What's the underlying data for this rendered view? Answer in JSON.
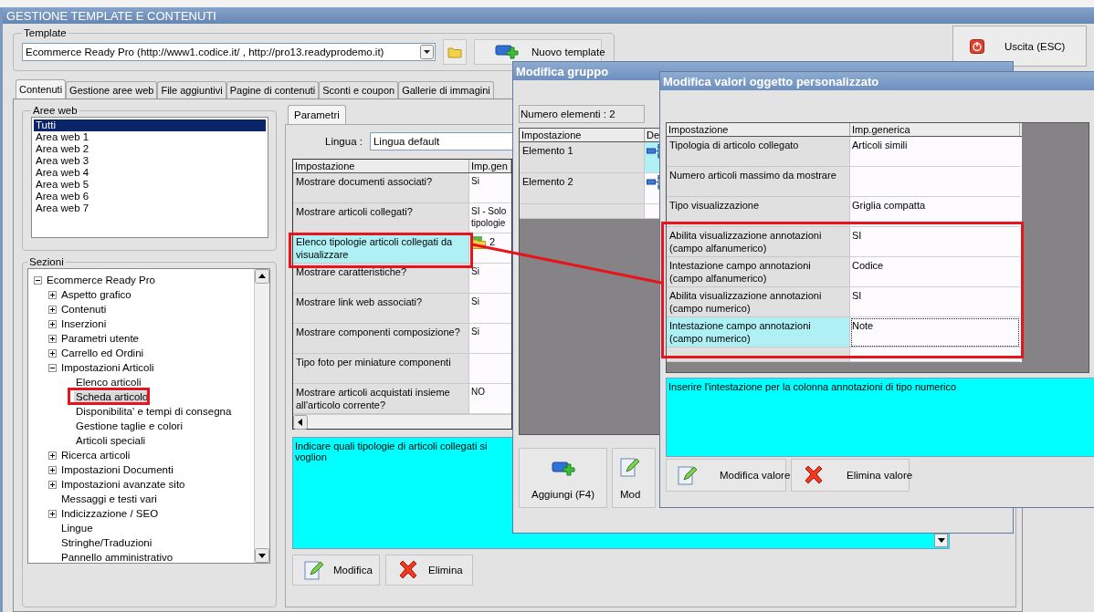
{
  "window": {
    "title": "GESTIONE TEMPLATE E CONTENUTI"
  },
  "template": {
    "label": "Template",
    "value": "Ecommerce Ready Pro (http://www1.codice.it/ , http://pro13.readyprodemo.it)",
    "new_button": "Nuovo template"
  },
  "exit_button": "Uscita (ESC)",
  "tabs": [
    {
      "label": "Contenuti",
      "selected": true
    },
    {
      "label": "Gestione aree web",
      "selected": false
    },
    {
      "label": "File aggiuntivi",
      "selected": false
    },
    {
      "label": "Pagine di contenuti",
      "selected": false
    },
    {
      "label": "Sconti e coupon",
      "selected": false
    },
    {
      "label": "Gallerie di immagini",
      "selected": false
    }
  ],
  "web_areas": {
    "label": "Aree web",
    "items": [
      {
        "label": "Tutti",
        "selected": true
      },
      {
        "label": "Area web 1",
        "selected": false
      },
      {
        "label": "Area web 2",
        "selected": false
      },
      {
        "label": "Area web 3",
        "selected": false
      },
      {
        "label": "Area web 4",
        "selected": false
      },
      {
        "label": "Area web 5",
        "selected": false
      },
      {
        "label": "Area web 6",
        "selected": false
      },
      {
        "label": "Area web 7",
        "selected": false
      }
    ]
  },
  "sections": {
    "label": "Sezioni",
    "tree": [
      {
        "label": "Ecommerce Ready Pro",
        "expanded": true,
        "selected": false,
        "children": [
          {
            "label": "Aspetto grafico",
            "expanded": false,
            "selected": false
          },
          {
            "label": "Contenuti",
            "expanded": false,
            "selected": false
          },
          {
            "label": "Inserzioni",
            "expanded": false,
            "selected": false
          },
          {
            "label": "Parametri utente",
            "expanded": false,
            "selected": false
          },
          {
            "label": "Carrello ed Ordini",
            "expanded": false,
            "selected": false
          },
          {
            "label": "Impostazioni Articoli",
            "expanded": true,
            "selected": false,
            "children": [
              {
                "label": "Elenco articoli",
                "selected": false
              },
              {
                "label": "Scheda articolo",
                "selected": true
              },
              {
                "label": "Disponibilita' e tempi di consegna",
                "selected": false
              },
              {
                "label": "Gestione taglie e colori",
                "selected": false
              },
              {
                "label": "Articoli speciali",
                "selected": false
              }
            ]
          },
          {
            "label": "Ricerca articoli",
            "expanded": false,
            "selected": false
          },
          {
            "label": "Impostazioni Documenti",
            "expanded": false,
            "selected": false
          },
          {
            "label": "Impostazioni avanzate sito",
            "expanded": false,
            "selected": false
          },
          {
            "label": "Messaggi e testi vari",
            "selected": false
          },
          {
            "label": "Indicizzazione / SEO",
            "expanded": false,
            "selected": false
          },
          {
            "label": "Lingue",
            "selected": false
          },
          {
            "label": "Stringhe/Traduzioni",
            "selected": false
          },
          {
            "label": "Pannello amministrativo",
            "selected": false
          }
        ]
      }
    ]
  },
  "params": {
    "tab": "Parametri",
    "language_label": "Lingua :",
    "language": "Lingua default",
    "columns": [
      "Impostazione",
      "Imp.gen"
    ],
    "rows": [
      {
        "kind": "text",
        "setting": "Mostrare documenti associati?",
        "value": "Si",
        "selected": false
      },
      {
        "kind": "text",
        "setting": "Mostrare articoli collegati?",
        "value": "SI - Solo tipologie",
        "selected": false
      },
      {
        "kind": "folder",
        "setting": "Elenco tipologie articoli collegati da visualizzare",
        "value": "2",
        "selected": true
      },
      {
        "kind": "text",
        "setting": "Mostrare caratteristiche?",
        "value": "Si",
        "selected": false
      },
      {
        "kind": "text",
        "setting": "Mostrare link web associati?",
        "value": "Si",
        "selected": false
      },
      {
        "kind": "text",
        "setting": "Mostrare componenti composizione?",
        "value": "Si",
        "selected": false
      },
      {
        "kind": "text",
        "setting": "Tipo foto per miniature componenti",
        "value": "",
        "selected": false
      },
      {
        "kind": "text",
        "setting": "Mostrare articoli acquistati insieme all'articolo corrente?",
        "value": "NO",
        "selected": false
      }
    ],
    "description": "Indicare quali tipologie di articoli collegati si voglion",
    "buttons": [
      "Modifica",
      "Elimina"
    ]
  },
  "group_dialog": {
    "title": "Modifica gruppo",
    "count": "Numero elementi : 2",
    "columns": [
      "Impostazione",
      "De"
    ],
    "rows": [
      {
        "label": "Elemento 1",
        "selected": true
      },
      {
        "label": "Elemento 2",
        "selected": false
      }
    ],
    "buttons": [
      "Aggiungi (F4)",
      "Mod"
    ]
  },
  "values_dialog": {
    "title": "Modifica valori oggetto personalizzato",
    "columns": [
      "Impostazione",
      "Imp.generica"
    ],
    "rows": [
      {
        "setting": "Tipologia di articolo collegato",
        "value": "Articoli simili",
        "selected": false
      },
      {
        "setting": "Numero articoli massimo da mostrare",
        "value": "",
        "selected": false
      },
      {
        "setting": "Tipo visualizzazione",
        "value": "Griglia compatta",
        "selected": false
      },
      {
        "setting": "Abilita visualizzazione annotazioni (campo alfanumerico)",
        "value": "SI",
        "selected": false
      },
      {
        "setting": "Intestazione campo annotazioni (campo alfanumerico)",
        "value": "Codice",
        "selected": false
      },
      {
        "setting": "Abilita visualizzazione annotazioni (campo numerico)",
        "value": "SI",
        "selected": false
      },
      {
        "setting": "Intestazione campo annotazioni (campo numerico)",
        "value": "Note",
        "selected": true
      }
    ],
    "description": "Inserire l'intestazione per la colonna annotazioni di tipo numerico",
    "buttons": [
      "Modifica valore",
      "Elimina valore"
    ]
  }
}
